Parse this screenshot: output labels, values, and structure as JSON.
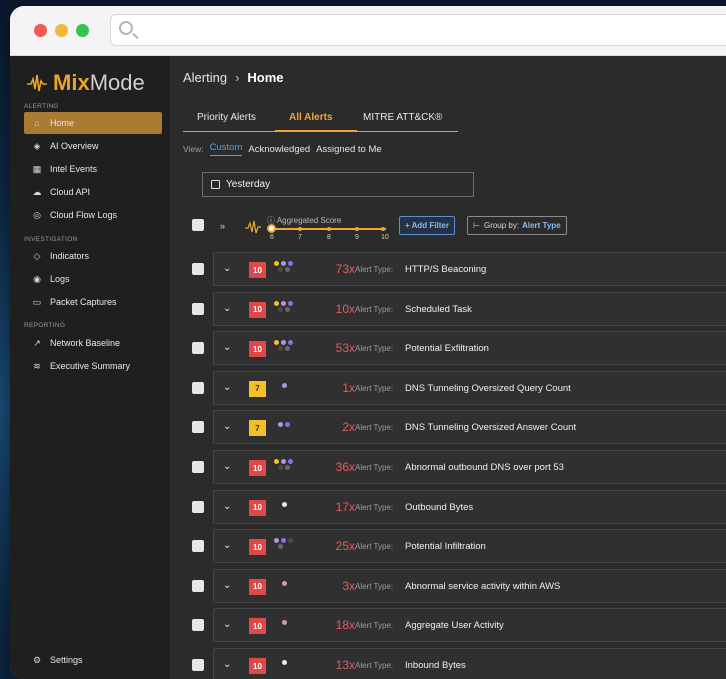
{
  "app": {
    "brand_mix": "Mix",
    "brand_mode": "Mode"
  },
  "sidebar": {
    "sections": [
      {
        "label": "ALERTING",
        "items": [
          {
            "label": "Home",
            "icon": "home-icon",
            "active": true
          },
          {
            "label": "AI Overview",
            "icon": "ai-icon"
          },
          {
            "label": "Intel Events",
            "icon": "grid-icon"
          },
          {
            "label": "Cloud API",
            "icon": "cloud-icon"
          },
          {
            "label": "Cloud Flow Logs",
            "icon": "cloud-flow-icon"
          }
        ]
      },
      {
        "label": "INVESTIGATION",
        "items": [
          {
            "label": "Indicators",
            "icon": "bulb-icon"
          },
          {
            "label": "Logs",
            "icon": "logs-icon"
          },
          {
            "label": "Packet Captures",
            "icon": "packet-icon"
          }
        ]
      },
      {
        "label": "REPORTING",
        "items": [
          {
            "label": "Network Baseline",
            "icon": "trend-icon"
          },
          {
            "label": "Executive Summary",
            "icon": "layers-icon"
          }
        ]
      }
    ],
    "settings_label": "Settings"
  },
  "header": {
    "crumb_parent": "Alerting",
    "crumb_current": "Home"
  },
  "tabs": [
    {
      "label": "Priority Alerts"
    },
    {
      "label": "All Alerts",
      "active": true
    },
    {
      "label": "MITRE ATT&CK®"
    }
  ],
  "view": {
    "label": "View:",
    "options": [
      "Custom",
      "Acknowledged",
      "Assigned to Me"
    ],
    "selected": "Custom"
  },
  "date_filter": {
    "value": "Yesterday"
  },
  "filters": {
    "aggregated_label": "Aggregated Score",
    "score_ticks": [
      "6",
      "7",
      "8",
      "9",
      "10"
    ],
    "add_filter": "+ Add Filter",
    "group_by_label": "Group by:",
    "group_by_value": "Alert Type"
  },
  "alert_type_label": "Alert Type:",
  "alerts": [
    {
      "score": "10",
      "level": "red",
      "count": "73x",
      "type": "HTTP/S Beaconing",
      "dots": [
        "#f2c029",
        "#b392e8",
        "#8c6fe0",
        "#4a4a4a",
        "#6a6a6a"
      ]
    },
    {
      "score": "10",
      "level": "red",
      "count": "10x",
      "type": "Scheduled Task",
      "dots": [
        "#f2c029",
        "#b392e8",
        "#8c6fe0",
        "#4a4a4a",
        "#6a6a6a"
      ]
    },
    {
      "score": "10",
      "level": "red",
      "count": "53x",
      "type": "Potential Exfiltration",
      "dots": [
        "#f2c029",
        "#b392e8",
        "#8c6fe0",
        "#4a4a4a",
        "#6a6a6a"
      ]
    },
    {
      "score": "7",
      "level": "yellow",
      "count": "1x",
      "type": "DNS Tunneling Oversized Query Count",
      "dots": [
        "#b392e8"
      ]
    },
    {
      "score": "7",
      "level": "yellow",
      "count": "2x",
      "type": "DNS Tunneling Oversized Answer Count",
      "dots": [
        "#b392e8",
        "#8c6fe0"
      ]
    },
    {
      "score": "10",
      "level": "red",
      "count": "36x",
      "type": "Abnormal outbound DNS over port 53",
      "dots": [
        "#f2c029",
        "#b392e8",
        "#8c6fe0",
        "#4a4a4a",
        "#6a6a6a"
      ]
    },
    {
      "score": "10",
      "level": "red",
      "count": "17x",
      "type": "Outbound Bytes",
      "dots": [
        "#ececec"
      ]
    },
    {
      "score": "10",
      "level": "red",
      "count": "25x",
      "type": "Potential Infiltration",
      "dots": [
        "#b392e8",
        "#8c6fe0",
        "#4a4a4a",
        "#6a6a6a"
      ]
    },
    {
      "score": "10",
      "level": "red",
      "count": "3x",
      "type": "Abnormal service activity within AWS",
      "dots": [
        "#c9a0a8"
      ]
    },
    {
      "score": "10",
      "level": "red",
      "count": "18x",
      "type": "Aggregate User Activity",
      "dots": [
        "#c9a0a8"
      ]
    },
    {
      "score": "10",
      "level": "red",
      "count": "13x",
      "type": "Inbound Bytes",
      "dots": [
        "#ececec"
      ]
    }
  ]
}
